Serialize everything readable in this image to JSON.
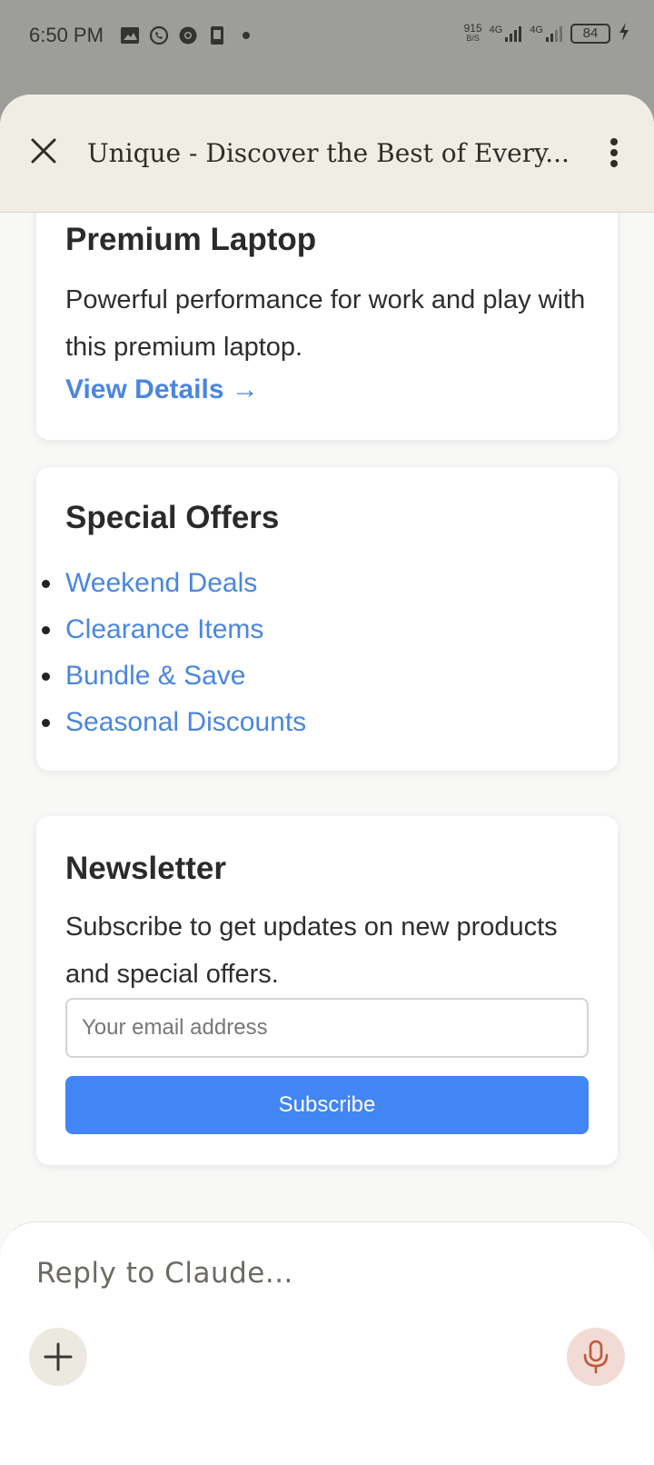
{
  "status_bar": {
    "time": "6:50 PM",
    "net_speed_value": "915",
    "net_speed_unit": "B/S",
    "signal1": "4G",
    "signal2": "4G",
    "battery": "84",
    "icons": [
      "gallery-icon",
      "whatsapp-icon",
      "chrome-icon",
      "phone-icon",
      "dot-icon"
    ]
  },
  "header": {
    "title": "Unique - Discover the Best of Every..."
  },
  "cards": {
    "laptop": {
      "title": "Premium Laptop",
      "description": "Powerful performance for work and play with this premium laptop.",
      "link": "View Details →"
    },
    "offers": {
      "title": "Special Offers",
      "items": [
        "Weekend Deals",
        "Clearance Items",
        "Bundle & Save",
        "Seasonal Discounts"
      ]
    },
    "newsletter": {
      "title": "Newsletter",
      "description": "Subscribe to get updates on new products and special offers.",
      "email_placeholder": "Your email address",
      "button": "Subscribe"
    }
  },
  "composer": {
    "placeholder": "Reply to Claude..."
  },
  "colors": {
    "accent_link": "#4a86e0",
    "button_blue": "#4285f4",
    "mic_color": "#c0583d"
  }
}
